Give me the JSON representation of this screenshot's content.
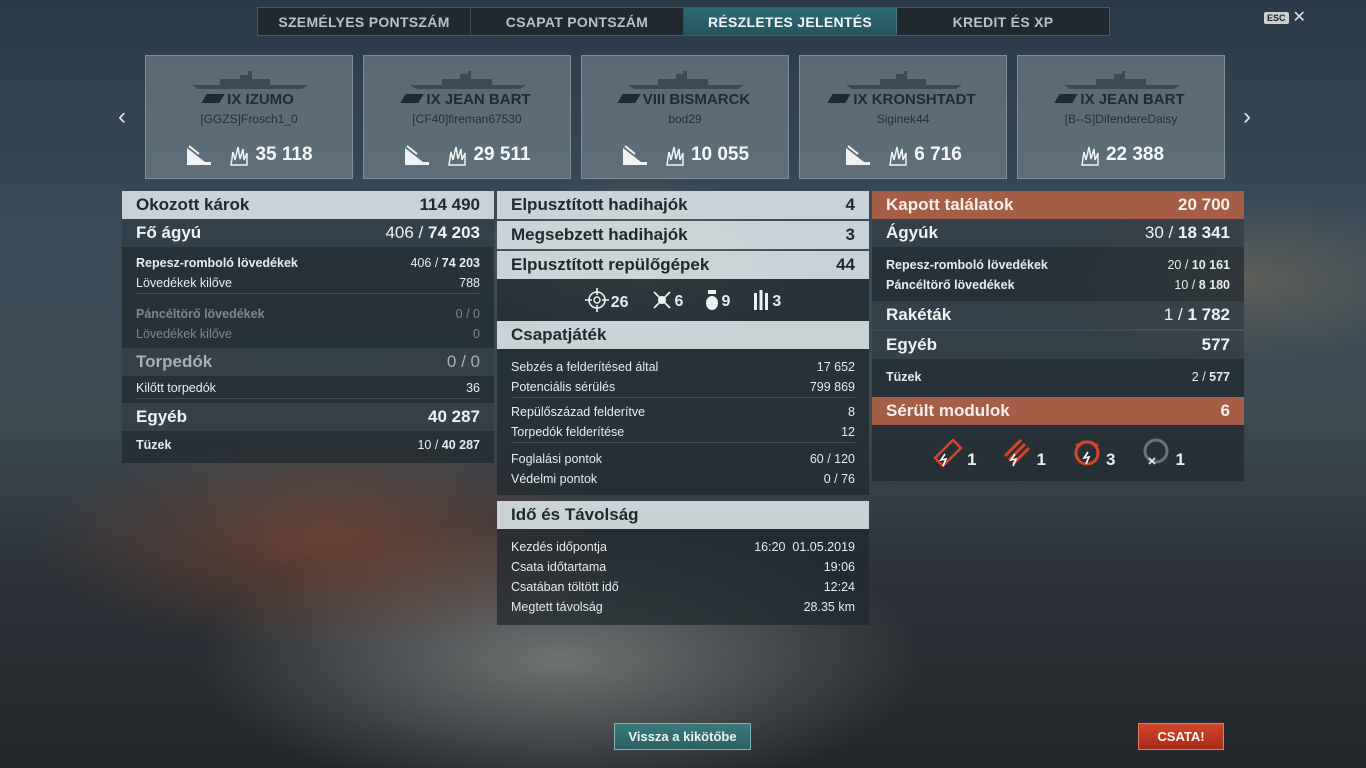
{
  "tabs": [
    {
      "label": "SZEMÉLYES PONTSZÁM"
    },
    {
      "label": "CSAPAT PONTSZÁM"
    },
    {
      "label": "RÉSZLETES JELENTÉS"
    },
    {
      "label": "KREDIT ÉS XP"
    }
  ],
  "esc": {
    "key": "ESC",
    "close": "✕"
  },
  "nav": {
    "prev": "‹",
    "next": "›"
  },
  "cards": [
    {
      "ship": "IX IZUMO",
      "player": "[GGZS]Frosch1_0",
      "damage": "35 118"
    },
    {
      "ship": "IX JEAN BART",
      "player": "[CF40]fireman67530",
      "damage": "29 511"
    },
    {
      "ship": "VIII BISMARCK",
      "player": "bod29",
      "damage": "10 055"
    },
    {
      "ship": "IX KRONSHTADT",
      "player": "Siginek44",
      "damage": "6 716"
    },
    {
      "ship": "IX JEAN BART",
      "player": "[B--S]DifendereDaisy",
      "damage": "22 388"
    }
  ],
  "left": {
    "damage_label": "Okozott károk",
    "damage_value": "114 490",
    "main_label": "Fő ágyú",
    "main_hits": "406",
    "main_total": "74 203",
    "he_label": "Repesz-romboló lövedékek",
    "he_hits": "406",
    "he_total": "74 203",
    "he_fired_label": "Lövedékek kilőve",
    "he_fired": "788",
    "ap_label": "Páncéltörő lövedékek",
    "ap_value": "0 / 0",
    "ap_fired_label": "Lövedékek kilőve",
    "ap_fired": "0",
    "torp_label": "Torpedók",
    "torp_value": "0 / 0",
    "torp_fired_label": "Kilőtt torpedók",
    "torp_fired": "36",
    "other_label": "Egyéb",
    "other_value": "40 287",
    "fire_label": "Tüzek",
    "fire_count": "10",
    "fire_total": "40 287"
  },
  "middle": {
    "destroyed_label": "Elpusztított hadihajók",
    "destroyed_value": "4",
    "damaged_label": "Megsebzett hadihajók",
    "damaged_value": "3",
    "planes_label": "Elpusztított repülőgépek",
    "planes_value": "44",
    "ribbons": [
      {
        "icon": "crosshair-icon",
        "value": "26"
      },
      {
        "icon": "shot-down-icon",
        "value": "6"
      },
      {
        "icon": "bomb-icon",
        "value": "9"
      },
      {
        "icon": "torpedo-icon",
        "value": "3"
      }
    ],
    "team_label": "Csapatjáték",
    "team_rows": [
      {
        "label": "Sebzés a felderítésed által",
        "value": "17 652"
      },
      {
        "label": "Potenciális sérülés",
        "value": "799 869"
      },
      {
        "label": "Repülőszázad felderítve",
        "value": "8"
      },
      {
        "label": "Torpedók felderítése",
        "value": "12"
      },
      {
        "label": "Foglalási pontok",
        "value": "60 / 120"
      },
      {
        "label": "Védelmi pontok",
        "value": "0 / 76"
      }
    ],
    "time_label": "Idő és Távolság",
    "time_rows": [
      {
        "label": "Kezdés időpontja",
        "value": "16:20  01.05.2019"
      },
      {
        "label": "Csata időtartama",
        "value": "19:06"
      },
      {
        "label": "Csatában töltött idő",
        "value": "12:24"
      },
      {
        "label": "Megtett távolság",
        "value": "28.35 km"
      }
    ]
  },
  "right": {
    "received_label": "Kapott találatok",
    "received_value": "20 700",
    "guns_label": "Ágyúk",
    "guns_hits": "30",
    "guns_total": "18 341",
    "he_label": "Repesz-romboló lövedékek",
    "he_hits": "20",
    "he_total": "10 161",
    "ap_label": "Páncéltörő lövedékek",
    "ap_hits": "10",
    "ap_total": "8 180",
    "rockets_label": "Rakéták",
    "rockets_hits": "1",
    "rockets_total": "1 782",
    "other_label": "Egyéb",
    "other_value": "577",
    "fire_label": "Tüzek",
    "fire_count": "2",
    "fire_total": "577",
    "modules_label": "Sérült modulok",
    "modules_value": "6",
    "modules": [
      {
        "icon": "main-battery-icon",
        "value": "1"
      },
      {
        "icon": "torpedo-tubes-icon",
        "value": "1"
      },
      {
        "icon": "secondary-battery-icon",
        "value": "3"
      },
      {
        "icon": "aa-gun-icon",
        "value": "1"
      }
    ]
  },
  "buttons": {
    "back": "Vissza a kikötőbe",
    "battle": "CSATA!"
  },
  "colors": {
    "accent_teal": "#2e6a74",
    "received_orange": "#b06044",
    "battle_red": "#d2452a"
  }
}
